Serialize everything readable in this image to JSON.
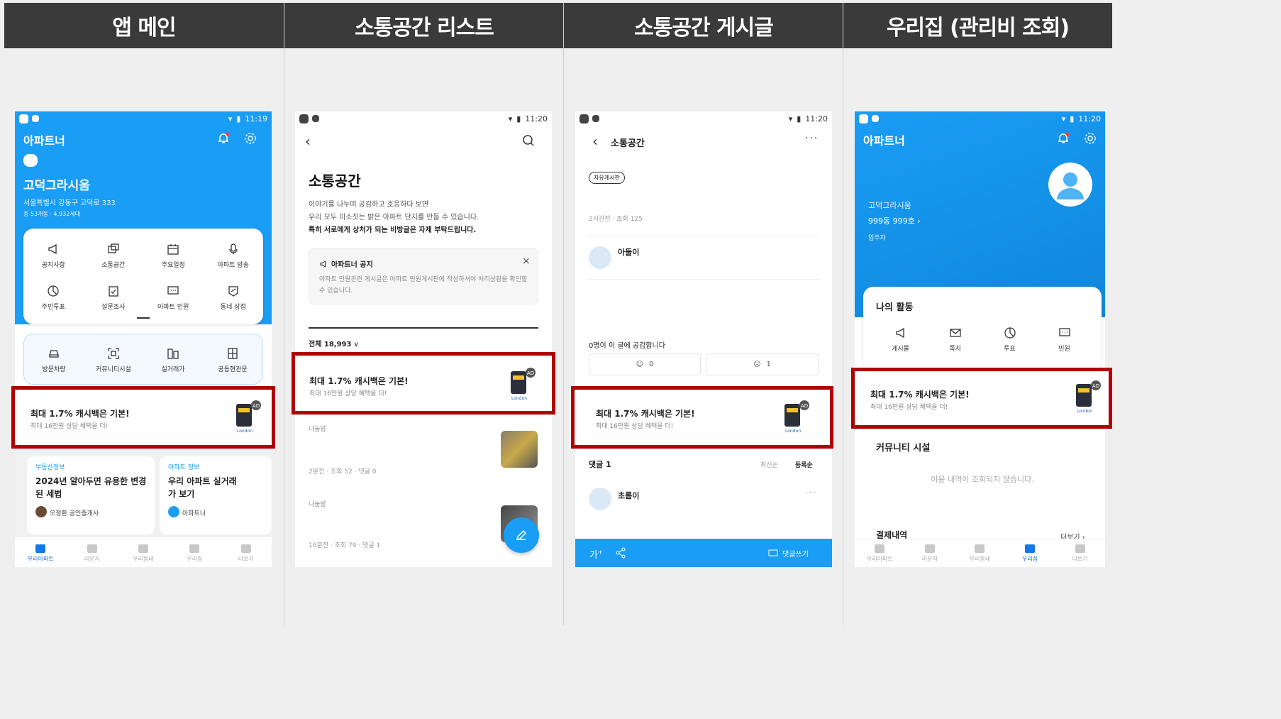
{
  "columns": [
    "앱 메인",
    "소통공간 리스트",
    "소통공간 게시글",
    "우리집 (관리비 조회)"
  ],
  "status": {
    "time1": "11:19",
    "time2": "11:20"
  },
  "ad": {
    "title": "최대 1.7% 캐시백은 기본!",
    "subtitle": "최대 16만원 상당 혜택을 더!",
    "badge": "AD",
    "card_brand": "London"
  },
  "colors": {
    "primary": "#1a9df5",
    "highlight": "#b10000",
    "header": "#3a3a3a"
  },
  "tabs": [
    "우리아파트",
    "라운지",
    "우리동네",
    "우리집",
    "더보기"
  ],
  "s1": {
    "app_title": "아파트너",
    "apt_name": "고덕그라시움",
    "address": "서울특별시 강동구 고덕로 333",
    "stats": "총 53개동 · 4,932세대",
    "menu": [
      "공지사항",
      "소통공간",
      "주요일정",
      "아파트 방송",
      "주민투표",
      "설문조사",
      "아파트 민원",
      "동네 상점"
    ],
    "menu2": [
      "방문차량",
      "커뮤니티시설",
      "실거래가",
      "공동현관문"
    ],
    "card1_tag": "부동산정보",
    "card1_title": "2024년 알아두면 유용한 변경된 세법",
    "card1_author": "오정환 공인중개사",
    "card2_tag": "아파트 정보",
    "card2_title": "우리 아파트 실거래가 보기",
    "card2_author": "아파트너"
  },
  "s2": {
    "title": "소통공간",
    "desc1": "이야기를 나누며 공감하고 호응하다 보면",
    "desc2": "우리 모두 미소짓는 밝은 아파트 단지를 만들 수 있습니다.",
    "desc3": "특히 서로에게 상처가 되는 비방글은 자제 부탁드립니다.",
    "notice_title": "아파트너 공지",
    "notice_body": "아파트 민원관련 게시글은 아파트 민원게시판에 작성하셔야 처리상황을 확인할 수 있습니다.",
    "filter": "전체 18,993",
    "post1_cat": "나눔방",
    "post1_meta": "2분전 · 조회 52 · 댓글 0",
    "post2_cat": "나눔방",
    "post2_meta": "16분전 · 조회 79 · 댓글 1"
  },
  "s3": {
    "title": "소통공간",
    "board_tag": "자유게시판",
    "meta": "2시간전 · 조회 125",
    "author": "아둘이",
    "empathy": "0명이 이 글에 공감합니다",
    "like_count": "0",
    "dislike_count": "1",
    "comments_label": "댓글 1",
    "sort_latest": "최신순",
    "sort_reg": "등록순",
    "commenter": "초롬이",
    "font_btn": "가",
    "write_comment": "댓글쓰기"
  },
  "s4": {
    "app_title": "아파트너",
    "apt_name": "고덕그라시움",
    "unit": "999동 999호 ›",
    "role": "입주자",
    "activity_title": "나의 활동",
    "activity": [
      "게시물",
      "쪽지",
      "투표",
      "민원"
    ],
    "community_title": "커뮤니티 시설",
    "community_empty": "이용 내역이 조회되지 않습니다.",
    "payment_title": "결제내역",
    "more": "더보기 ›"
  }
}
